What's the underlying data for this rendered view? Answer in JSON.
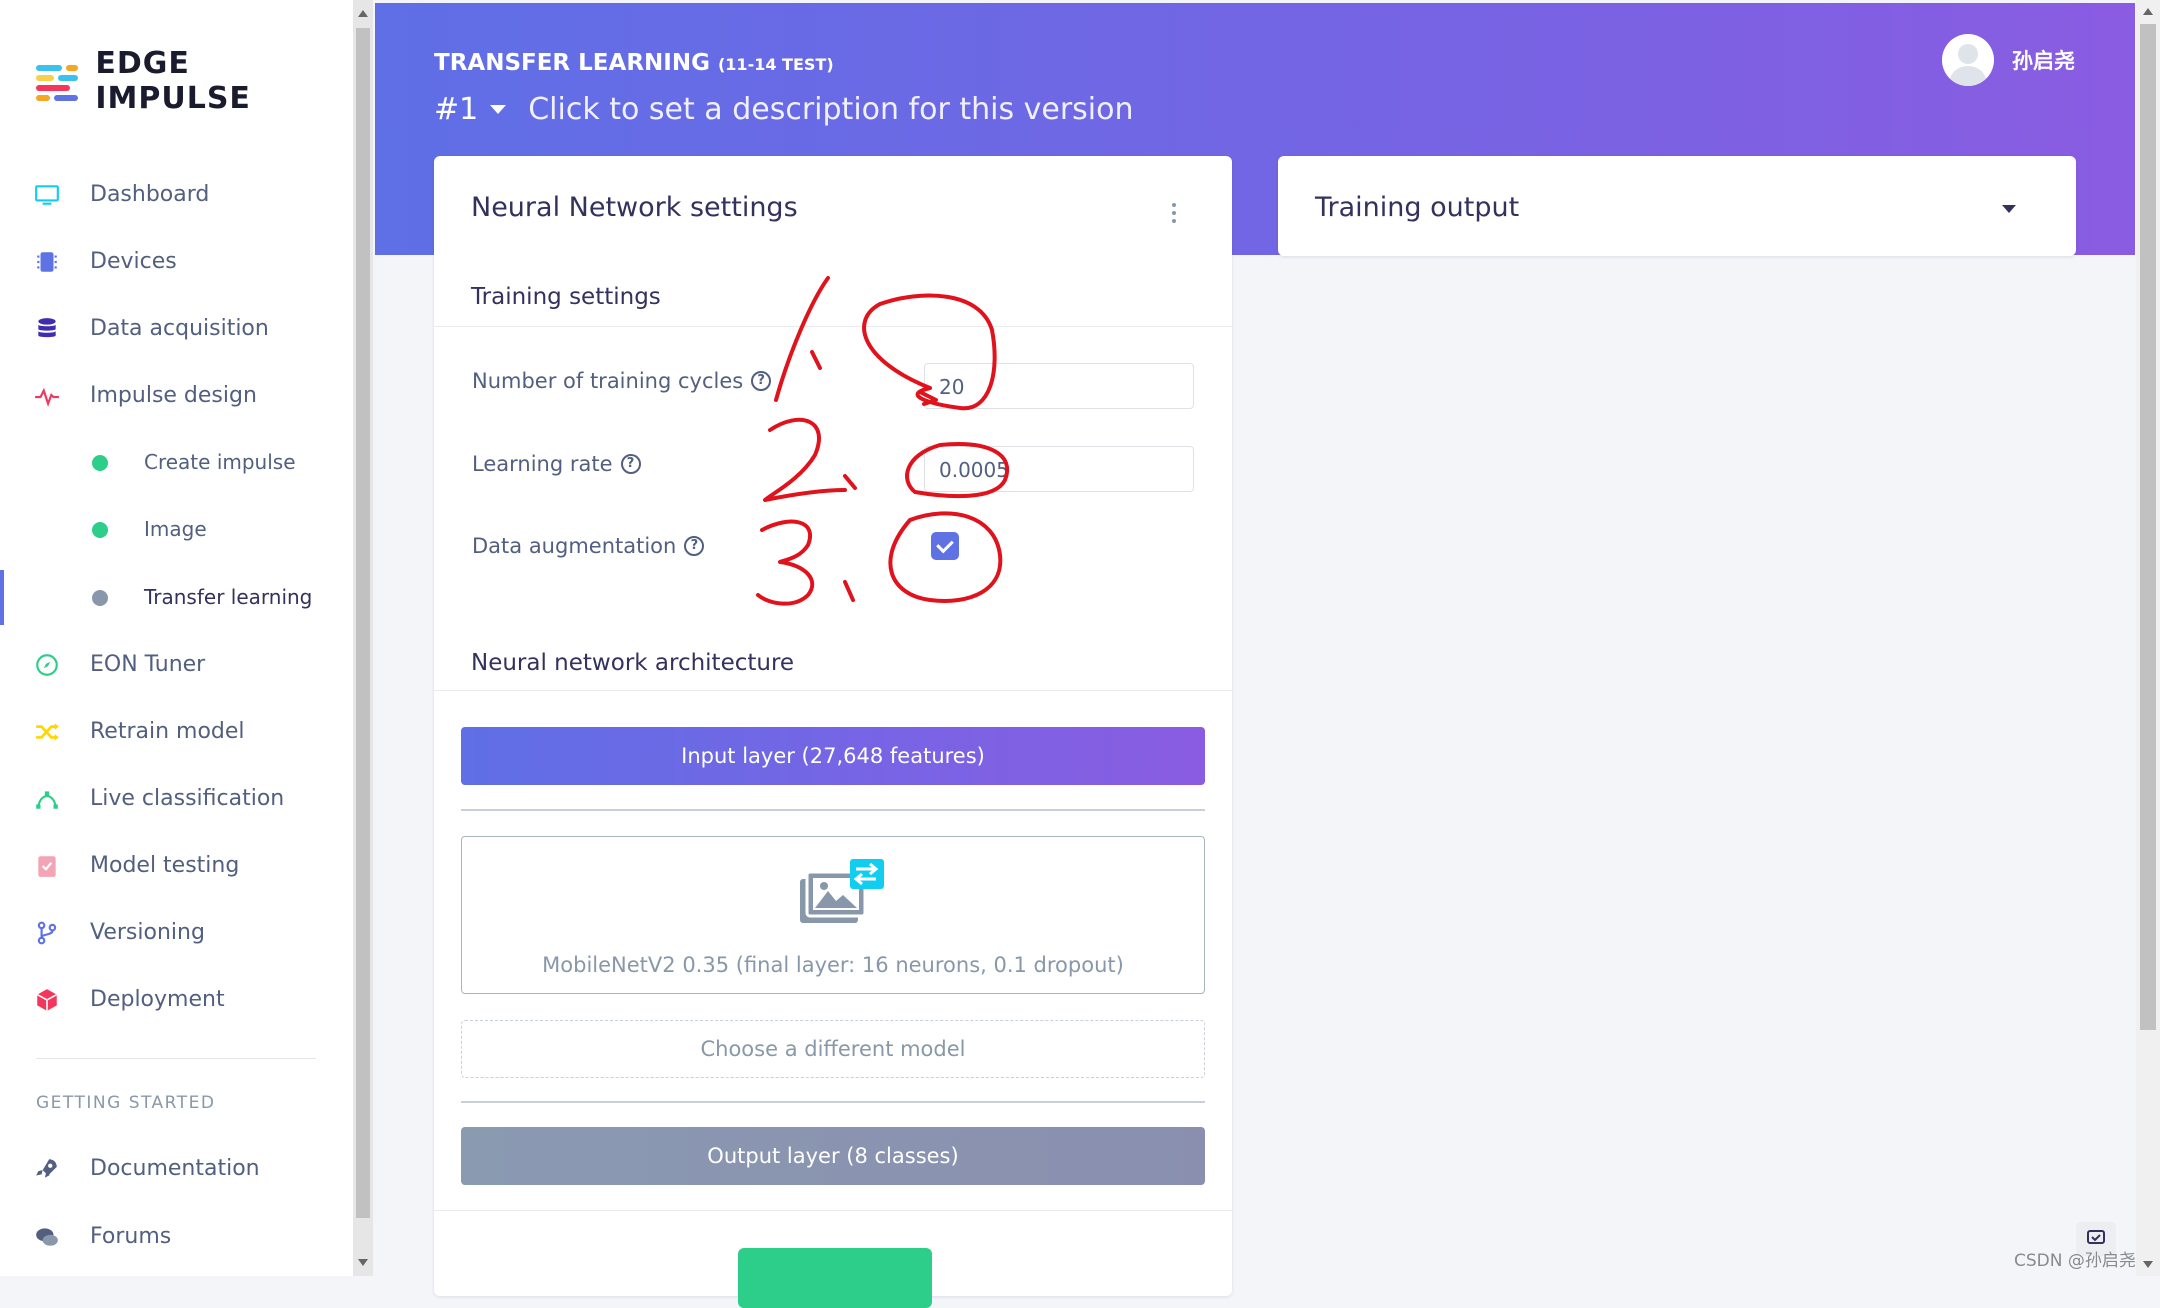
{
  "brand": {
    "name": "EDGE IMPULSE"
  },
  "sidebar": {
    "items": [
      {
        "label": "Dashboard",
        "icon": "monitor-icon",
        "color": "#11cdef"
      },
      {
        "label": "Devices",
        "icon": "chip-icon",
        "color": "#5e72e4"
      },
      {
        "label": "Data acquisition",
        "icon": "database-icon",
        "color": "#3f2cb0"
      },
      {
        "label": "Impulse design",
        "icon": "pulse-icon",
        "color": "#f5365c"
      },
      {
        "label": "Create impulse",
        "status": "#2dce89"
      },
      {
        "label": "Image",
        "status": "#2dce89"
      },
      {
        "label": "Transfer learning",
        "status": "#8898aa"
      },
      {
        "label": "EON Tuner",
        "icon": "compass-icon",
        "color": "#2dce89"
      },
      {
        "label": "Retrain model",
        "icon": "shuffle-icon",
        "color": "#ffd600"
      },
      {
        "label": "Live classification",
        "icon": "bezier-icon",
        "color": "#2dce89"
      },
      {
        "label": "Model testing",
        "icon": "clipboard-check-icon",
        "color": "#f3a4b5"
      },
      {
        "label": "Versioning",
        "icon": "branch-icon",
        "color": "#5e72e4"
      },
      {
        "label": "Deployment",
        "icon": "cube-icon",
        "color": "#f5365c"
      }
    ],
    "section_title": "GETTING STARTED",
    "extra": [
      {
        "label": "Documentation",
        "icon": "rocket-icon"
      },
      {
        "label": "Forums",
        "icon": "chat-icon"
      }
    ]
  },
  "header": {
    "title": "TRANSFER LEARNING",
    "subtitle": "(11-14 TEST)",
    "version": "#1",
    "description": "Click to set a description for this version",
    "user": "孙启尧"
  },
  "nn_card": {
    "title": "Neural Network settings",
    "training_section": "Training settings",
    "cycles_label": "Number of training cycles",
    "cycles_value": "20",
    "lr_label": "Learning rate",
    "lr_value": "0.0005",
    "aug_label": "Data augmentation",
    "aug_checked": true,
    "arch_section": "Neural network architecture",
    "input_layer": "Input layer (27,648 features)",
    "model_label": "MobileNetV2 0.35 (final layer: 16 neurons, 0.1 dropout)",
    "choose_model": "Choose a different model",
    "output_layer": "Output layer (8 classes)",
    "help_glyph": "?"
  },
  "output_card": {
    "title": "Training output"
  },
  "annotations": {
    "n1": "1、",
    "n2": "2、",
    "n3": "3、"
  },
  "watermark": "CSDN @孙启尧"
}
